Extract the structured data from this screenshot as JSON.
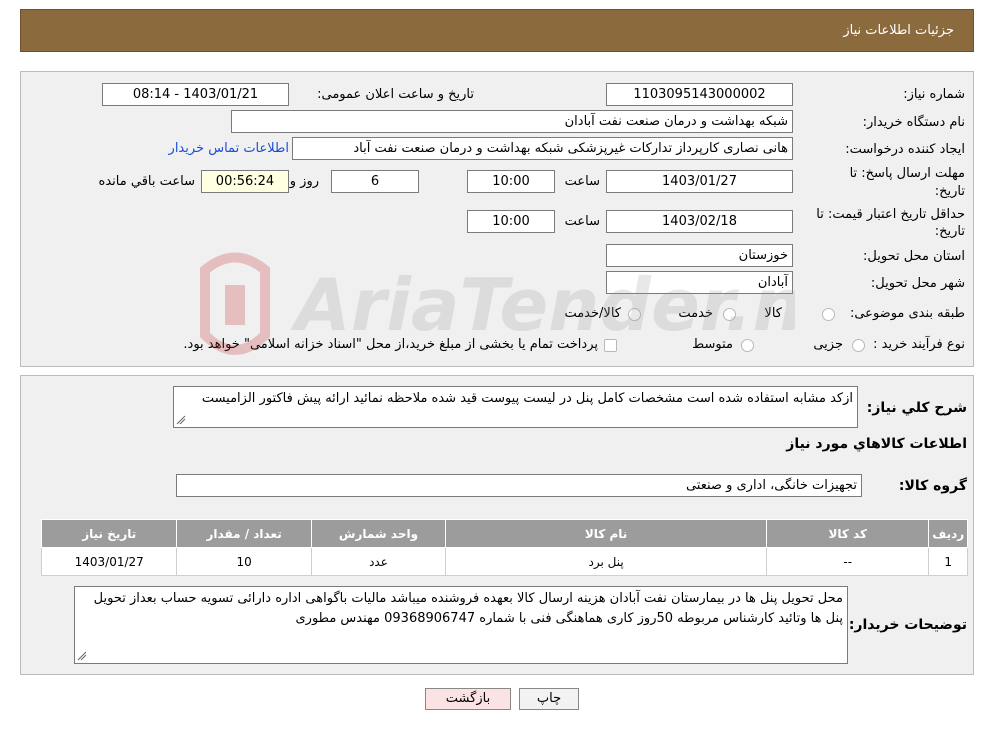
{
  "header": {
    "title": "جزئیات اطلاعات نیاز"
  },
  "form": {
    "need_number_label": "شماره نیاز:",
    "need_number": "1103095143000002",
    "announce_label": "تاریخ و ساعت اعلان عمومی:",
    "announce_value": "1403/01/21 - 08:14",
    "buyer_org_label": "نام دستگاه خریدار:",
    "buyer_org": "شبکه بهداشت و درمان صنعت نفت آبادان",
    "requester_label": "ایجاد کننده درخواست:",
    "requester": "هانی نصاری کارپرداز تدارکات غیرپزشکی شبکه بهداشت و درمان صنعت نفت آباد",
    "contact_link": "اطلاعات تماس خریدار",
    "deadline_label_1": "مهلت ارسال پاسخ: تا",
    "deadline_label_2": "تاریخ:",
    "deadline_date": "1403/01/27",
    "time_label": "ساعت",
    "deadline_time": "10:00",
    "days_value": "6",
    "days_label": "روز و",
    "remaining_time": "00:56:24",
    "remaining_label": "ساعت باقي مانده",
    "validity_label_1": "حداقل تاریخ اعتبار قیمت: تا",
    "validity_label_2": "تاریخ:",
    "validity_date": "1403/02/18",
    "validity_time": "10:00",
    "province_label": "استان محل تحویل:",
    "province": "خوزستان",
    "city_label": "شهر محل تحویل:",
    "city": "آبادان",
    "category_label": "طبقه بندی موضوعی:",
    "category_options": [
      "کالا",
      "خدمت",
      "کالا/خدمت"
    ],
    "process_label": "نوع فرآیند خرید :",
    "process_options": [
      "جزیی",
      "متوسط"
    ],
    "payment_note": "پرداخت تمام یا بخشی از مبلغ خرید،از محل \"اسناد خزانه اسلامی\" خواهد بود."
  },
  "description": {
    "label": "شرح کلي نياز:",
    "text": "ازکد مشابه استفاده شده است مشخصات کامل پنل در لیست پیوست قید شده ملاحظه نمائید ارائه پیش فاکتور الزامیست"
  },
  "goods": {
    "section_title": "اطلاعات کالاهاي مورد نياز",
    "group_label": "گروه کالا:",
    "group_value": "تجهیزات خانگی، اداری و صنعتی",
    "columns": [
      "رديف",
      "کد کالا",
      "نام کالا",
      "واحد شمارش",
      "تعداد / مقدار",
      "تاريخ نياز"
    ],
    "rows": [
      {
        "index": "1",
        "code": "--",
        "name": "پنل برد",
        "unit": "عدد",
        "qty": "10",
        "date": "1403/01/27"
      }
    ]
  },
  "buyer_notes": {
    "label": "توضیحات خریدار:",
    "text": "محل تحویل پنل ها در بیمارستان نفت آبادان هزینه ارسال کالا بعهده فروشنده میباشد مالیات باگواهی اداره دارائی تسویه حساب بعداز تحویل پنل ها وتائید کارشناس مربوطه 50روز کاری هماهنگی فنی با شماره 09368906747 مهندس مطوری"
  },
  "buttons": {
    "print": "چاپ",
    "back": "بازگشت"
  },
  "watermark": {
    "text": "AriaTender.neT"
  }
}
